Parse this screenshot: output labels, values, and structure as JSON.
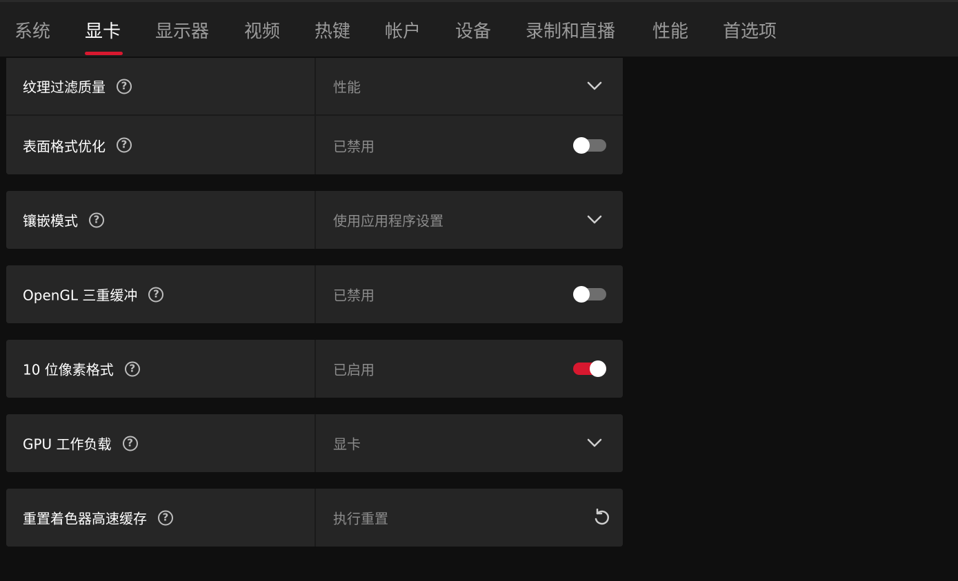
{
  "tabs": [
    {
      "label": "系统"
    },
    {
      "label": "显卡"
    },
    {
      "label": "显示器"
    },
    {
      "label": "视频"
    },
    {
      "label": "热键"
    },
    {
      "label": "帐户"
    },
    {
      "label": "设备"
    },
    {
      "label": "录制和直播"
    },
    {
      "label": "性能"
    },
    {
      "label": "首选项"
    }
  ],
  "active_tab": "显卡",
  "accent_color": "#d8182f",
  "settings": [
    {
      "label": "纹理过滤质量",
      "value": "性能",
      "control": "dropdown"
    },
    {
      "label": "表面格式优化",
      "value": "已禁用",
      "control": "toggle",
      "state": "off"
    },
    {
      "label": "镶嵌模式",
      "value": "使用应用程序设置",
      "control": "dropdown"
    },
    {
      "label": "OpenGL 三重缓冲",
      "value": "已禁用",
      "control": "toggle",
      "state": "off"
    },
    {
      "label": "10 位像素格式",
      "value": "已启用",
      "control": "toggle",
      "state": "on"
    },
    {
      "label": "GPU 工作负载",
      "value": "显卡",
      "control": "dropdown"
    },
    {
      "label": "重置着色器高速缓存",
      "value": "执行重置",
      "control": "reset-button"
    }
  ],
  "icons": {
    "help": "question-circle-icon",
    "dropdown": "chevron-down-icon",
    "reset": "reset-icon"
  }
}
